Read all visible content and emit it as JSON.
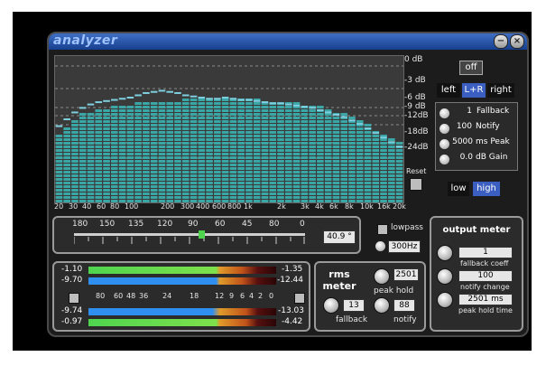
{
  "window": {
    "title": "analyzer",
    "minimize_icon": "minus-icon",
    "close_icon": "close-icon"
  },
  "spectrum": {
    "db_scale": [
      "0 dB",
      "-3 dB",
      "-6 dB",
      "-9 dB",
      "-12dB",
      "-18dB",
      "-24dB"
    ],
    "freq_scale": [
      "20",
      "30",
      "40",
      "60",
      "80",
      "100",
      "200",
      "300",
      "400",
      "600",
      "800",
      "1k",
      "2k",
      "3k",
      "4k",
      "6k",
      "8k",
      "10k",
      "16k",
      "20k"
    ],
    "reset_label": "Reset"
  },
  "controls": {
    "off_label": "off",
    "channels": [
      "left",
      "L+R",
      "right"
    ],
    "selected_channel": "L+R",
    "settings": [
      {
        "value": "1",
        "label": "Fallback"
      },
      {
        "value": "100",
        "label": "Notify"
      },
      {
        "value": "5000",
        "label": "ms Peak"
      },
      {
        "value": "0.0",
        "label": "dB Gain"
      }
    ],
    "resolution": [
      "low",
      "high"
    ],
    "selected_resolution": "high"
  },
  "correlation": {
    "scale": [
      "180",
      "150",
      "135",
      "120",
      "90",
      "60",
      "45",
      "80",
      "0"
    ],
    "value": "40.9 °",
    "level": 0.55,
    "lowpass_label": "lowpass",
    "lowpass_freq": "300Hz"
  },
  "levels": {
    "left_rms": "-1.10",
    "left_peak": "-9.70",
    "right_rms": "-1.35",
    "right_peak": "-12.44",
    "scale": [
      "80",
      "60",
      "48",
      "36",
      "24",
      "18",
      "12",
      "9",
      "6",
      "4",
      "2",
      "0"
    ],
    "left2_rms": "-9.74",
    "left2_peak": "-0.97",
    "right2_rms": "-13.03",
    "right2_peak": "-4.42"
  },
  "rms_meter": {
    "title": "rms meter",
    "peak_hold_value": "2501",
    "peak_hold_label": "peak hold",
    "fallback_value": "13",
    "fallback_label": "fallback",
    "notify_value": "88",
    "notify_label": "notify"
  },
  "output_meter": {
    "title": "output meter",
    "fallback_value": "1",
    "fallback_label": "fallback coeff",
    "notify_value": "100",
    "notify_label": "notify change",
    "peak_value": "2501 ms",
    "peak_label": "peak hold time"
  },
  "colors": {
    "bar": "#3aa6a6",
    "peak": "#7ed0e0",
    "accent": "#3b5fc0",
    "green": "#4fd44f",
    "blue": "#2f8ff0"
  },
  "spectrum_levels": [
    0.6,
    0.66,
    0.72,
    0.76,
    0.79,
    0.81,
    0.82,
    0.83,
    0.84,
    0.85,
    0.86,
    0.86,
    0.87,
    0.87,
    0.88,
    0.88,
    0.89,
    0.89,
    0.9,
    0.9,
    0.9,
    0.91,
    0.91,
    0.9,
    0.9,
    0.89,
    0.88,
    0.88,
    0.87,
    0.86,
    0.86,
    0.85,
    0.84,
    0.83,
    0.81,
    0.79,
    0.77,
    0.74,
    0.71,
    0.67,
    0.63,
    0.59,
    0.55,
    0.51
  ],
  "spectrum_peaks": [
    0.66,
    0.72,
    0.78,
    0.82,
    0.85,
    0.87,
    0.88,
    0.89,
    0.9,
    0.91,
    0.93,
    0.95,
    0.96,
    0.97,
    0.96,
    0.95,
    0.93,
    0.92,
    0.91,
    0.9,
    0.9,
    0.91,
    0.9,
    0.89,
    0.89,
    0.88,
    0.87,
    0.86,
    0.86,
    0.85,
    0.84,
    0.83,
    0.82,
    0.8,
    0.78,
    0.76,
    0.74,
    0.71,
    0.68,
    0.64,
    0.6,
    0.56,
    0.52,
    0.48
  ]
}
